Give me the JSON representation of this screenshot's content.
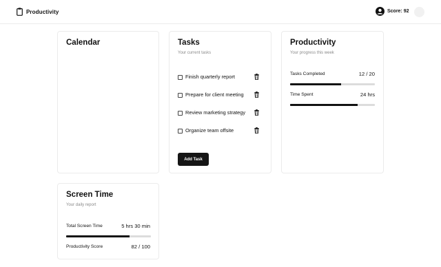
{
  "app": {
    "title": "Productivity",
    "score_text": "Score: 92"
  },
  "calendar": {
    "title": "Calendar"
  },
  "tasks": {
    "title": "Tasks",
    "subtitle": "Your current tasks",
    "items": [
      {
        "label": "Finish quarterly report",
        "checked": false
      },
      {
        "label": "Prepare for client meeting",
        "checked": false
      },
      {
        "label": "Review marketing strategy",
        "checked": false
      },
      {
        "label": "Organize team offsite",
        "checked": false
      }
    ],
    "add_button": "Add Task"
  },
  "productivity": {
    "title": "Productivity",
    "subtitle": "Your progress this week",
    "metrics": [
      {
        "label": "Tasks Completed",
        "value": "12 / 20",
        "progress": 0.6
      },
      {
        "label": "Time Spent",
        "value": "24 hrs",
        "progress": 0.8
      }
    ]
  },
  "screen_time": {
    "title": "Screen Time",
    "subtitle": "Your daily report",
    "metrics": [
      {
        "label": "Total Screen Time",
        "value": "5 hrs 30 min",
        "progress": 0.75
      },
      {
        "label": "Productivity Score",
        "value": "82 / 100"
      }
    ]
  },
  "icons": {
    "brand": "clipboard-icon",
    "user": "user-circle-icon",
    "delete": "trash-icon"
  },
  "colors": {
    "accent": "#111111",
    "track": "#dcdcdc",
    "border": "#ebebeb",
    "muted": "#8a8a8a"
  }
}
